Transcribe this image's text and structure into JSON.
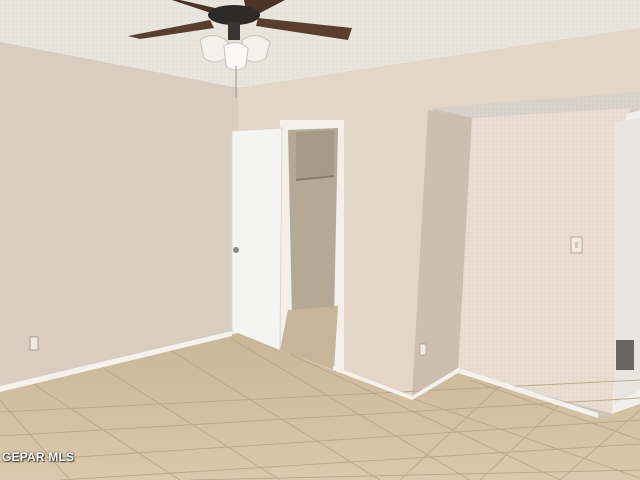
{
  "photo": {
    "subject": "empty-bedroom",
    "colors": {
      "ceiling": "#e9e4dc",
      "left_wall": "#d9cdc0",
      "back_wall": "#e3d6c6",
      "alcove_wall": "#e8ddd0",
      "floor_tile": "#d6c3a8",
      "grout": "#b8a387",
      "baseboard": "#f5f2ec",
      "door": "#f4f4f2"
    }
  },
  "watermark": {
    "text": "GEPAR MLS"
  }
}
